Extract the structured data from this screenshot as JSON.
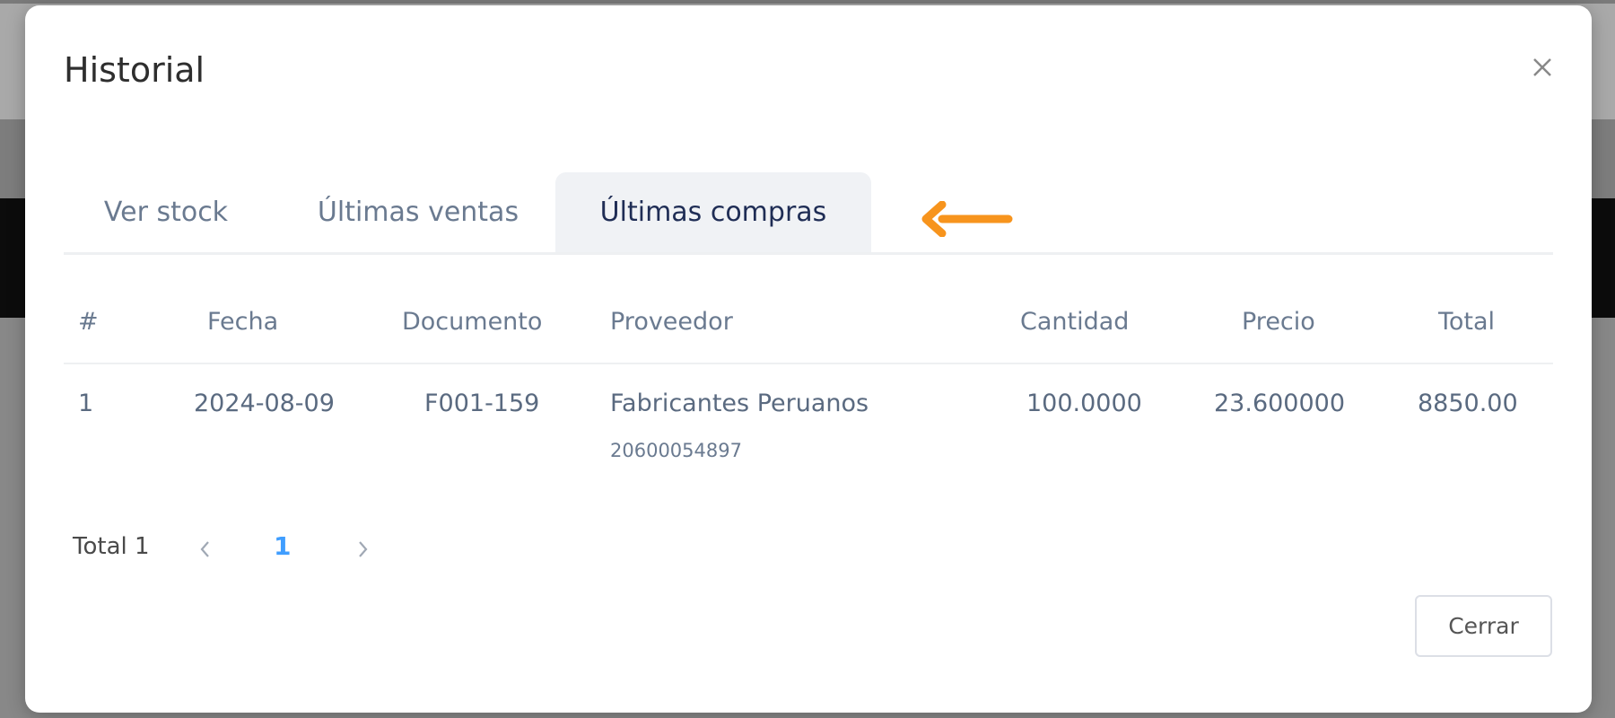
{
  "modal": {
    "title": "Historial",
    "close_icon": "close-icon"
  },
  "tabs": [
    {
      "label": "Ver stock",
      "active": false
    },
    {
      "label": "Últimas ventas",
      "active": false
    },
    {
      "label": "Últimas compras",
      "active": true
    }
  ],
  "table": {
    "headers": [
      "#",
      "Fecha",
      "Documento",
      "Proveedor",
      "Cantidad",
      "Precio",
      "Total"
    ],
    "rows": [
      {
        "index": "1",
        "fecha": "2024-08-09",
        "documento": "F001-159",
        "proveedor": "Fabricantes Peruanos",
        "proveedor_ruc": "20600054897",
        "cantidad": "100.0000",
        "precio": "23.600000",
        "total": "8850.00"
      }
    ]
  },
  "pagination": {
    "total_label": "Total 1",
    "current_page": "1",
    "prev_icon": "chevron-left-icon",
    "next_icon": "chevron-right-icon"
  },
  "footer": {
    "close_label": "Cerrar"
  },
  "colors": {
    "accent": "#409eff",
    "arrow": "#f7941d",
    "active_tab_bg": "#f0f2f5"
  }
}
